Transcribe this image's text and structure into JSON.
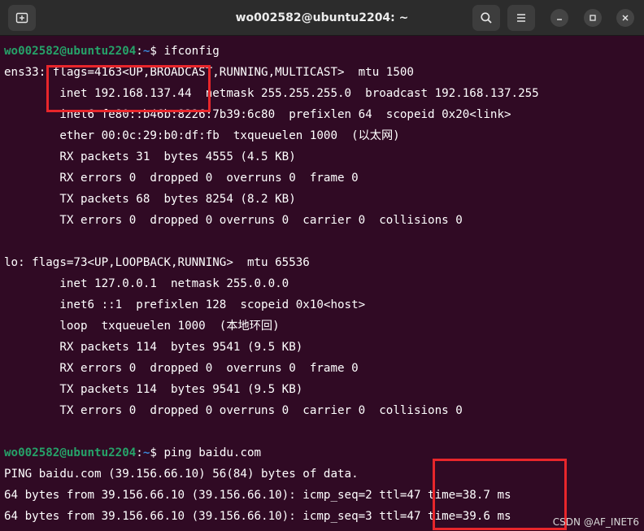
{
  "window": {
    "title": "wo002582@ubuntu2204: ~"
  },
  "titlebar_icons": {
    "new_tab": "new-tab-icon",
    "search": "search-icon",
    "menu": "hamburger-menu-icon",
    "minimize": "minimize-icon",
    "maximize": "maximize-icon",
    "close": "close-icon"
  },
  "prompt": {
    "user_host": "wo002582@ubuntu2204",
    "separator": ":",
    "path": "~",
    "symbol": "$ "
  },
  "commands": {
    "ifconfig": "ifconfig",
    "ping": "ping baidu.com"
  },
  "ens33": {
    "line1": "ens33: flags=4163<UP,BROADCAST,RUNNING,MULTICAST>  mtu 1500",
    "line2": "        inet 192.168.137.44  netmask 255.255.255.0  broadcast 192.168.137.255",
    "line3": "        inet6 fe80::b46b:8226:7b39:6c80  prefixlen 64  scopeid 0x20<link>",
    "line4": "        ether 00:0c:29:b0:df:fb  txqueuelen 1000  (以太网)",
    "line5": "        RX packets 31  bytes 4555 (4.5 KB)",
    "line6": "        RX errors 0  dropped 0  overruns 0  frame 0",
    "line7": "        TX packets 68  bytes 8254 (8.2 KB)",
    "line8": "        TX errors 0  dropped 0 overruns 0  carrier 0  collisions 0"
  },
  "lo": {
    "line1": "lo: flags=73<UP,LOOPBACK,RUNNING>  mtu 65536",
    "line2": "        inet 127.0.0.1  netmask 255.0.0.0",
    "line3": "        inet6 ::1  prefixlen 128  scopeid 0x10<host>",
    "line4": "        loop  txqueuelen 1000  (本地环回)",
    "line5": "        RX packets 114  bytes 9541 (9.5 KB)",
    "line6": "        RX errors 0  dropped 0  overruns 0  frame 0",
    "line7": "        TX packets 114  bytes 9541 (9.5 KB)",
    "line8": "        TX errors 0  dropped 0 overruns 0  carrier 0  collisions 0"
  },
  "ping_output": {
    "line1": "PING baidu.com (39.156.66.10) 56(84) bytes of data.",
    "line2": "64 bytes from 39.156.66.10 (39.156.66.10): icmp_seq=2 ttl=47 time=38.7 ms",
    "line3": "64 bytes from 39.156.66.10 (39.156.66.10): icmp_seq=3 ttl=47 time=39.6 ms"
  },
  "watermark": "CSDN @AF_INET6",
  "colors": {
    "background": "#300a24",
    "prompt_user": "#26a269",
    "prompt_path": "#3a86d6",
    "highlight_box": "#e8262b"
  }
}
